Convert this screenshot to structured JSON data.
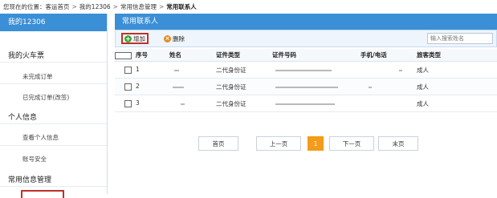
{
  "breadcrumb": {
    "prefix": "您现在的位置：",
    "items": [
      "客运首页",
      "我的12306",
      "常用信息管理",
      "常用联系人"
    ]
  },
  "sidebar": {
    "title": "我的12306",
    "sections": [
      {
        "label": "我的火车票",
        "items": [
          "未完成订单",
          "已完成订单(改签)"
        ]
      },
      {
        "label": "个人信息",
        "items": [
          "查看个人信息",
          "账号安全"
        ]
      },
      {
        "label": "常用信息管理",
        "items": []
      }
    ]
  },
  "panel": {
    "title": "常用联系人",
    "add_label": "增加",
    "delete_label": "删除",
    "search_placeholder": "输入搜索姓名"
  },
  "table": {
    "columns": [
      "序号",
      "姓名",
      "证件类型",
      "证件号码",
      "手机/电话",
      "旅客类型"
    ],
    "rows": [
      {
        "index": "1",
        "id_type": "二代身份证",
        "passenger_type": "成人"
      },
      {
        "index": "2",
        "id_type": "二代身份证",
        "passenger_type": "成人"
      },
      {
        "index": "3",
        "id_type": "二代身份证",
        "passenger_type": "成人"
      }
    ]
  },
  "pager": {
    "first": "首页",
    "prev": "上一页",
    "current": "1",
    "next": "下一页",
    "last": "末页"
  },
  "colors": {
    "header_blue": "#3a8fd6",
    "highlight_red": "#c0302a",
    "pager_active": "#f39b1a",
    "add_icon_green": "#3aa63a"
  }
}
